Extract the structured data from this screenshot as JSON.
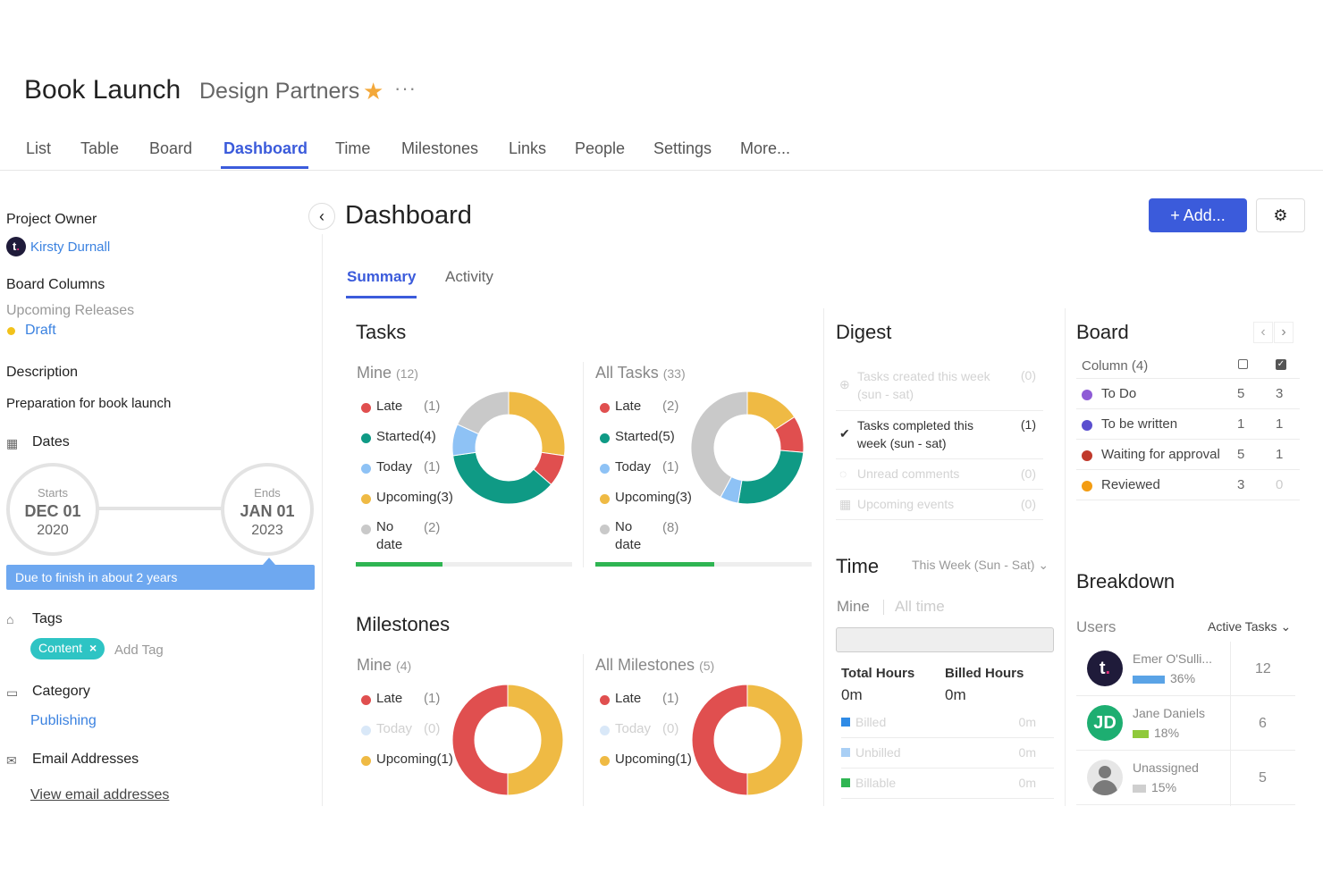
{
  "header": {
    "title": "Book Launch",
    "subtitle": "Design Partners",
    "star_icon": "star-icon",
    "more_icon": "ellipsis-icon"
  },
  "nav": {
    "tabs": [
      "List",
      "Table",
      "Board",
      "Dashboard",
      "Time",
      "Milestones",
      "Links",
      "People",
      "Settings",
      "More..."
    ],
    "active": "Dashboard"
  },
  "sidebar": {
    "project_owner_label": "Project Owner",
    "owner_name": "Kirsty Durnall",
    "board_columns_label": "Board Columns",
    "board_columns_group": "Upcoming Releases",
    "board_column_value": "Draft",
    "board_column_color": "#f2c21b",
    "description_label": "Description",
    "description_value": "Preparation for book launch",
    "dates_label": "Dates",
    "start": {
      "label": "Starts",
      "date": "DEC 01",
      "year": "2020"
    },
    "end": {
      "label": "Ends",
      "date": "JAN 01",
      "year": "2023"
    },
    "due_text": "Due to finish in about 2 years",
    "tags_label": "Tags",
    "tag": "Content",
    "tag_remove": "×",
    "add_tag": "Add Tag",
    "category_label": "Category",
    "category_value": "Publishing",
    "email_label": "Email Addresses",
    "email_link": "View email addresses"
  },
  "main": {
    "title": "Dashboard",
    "add_button": "+ Add...",
    "subtabs": [
      "Summary",
      "Activity"
    ]
  },
  "colors": {
    "late": "#e04f4f",
    "started": "#0f9a85",
    "today": "#8ec2f5",
    "upcoming": "#efba44",
    "nodate": "#c9c9c9",
    "accent": "#3b5bdb"
  },
  "tasks": {
    "title": "Tasks",
    "mine": {
      "label": "Mine",
      "count": "(12)",
      "legend": [
        {
          "label": "Late",
          "count": "(1)"
        },
        {
          "label": "Started(4)",
          "count": ""
        },
        {
          "label": "Today",
          "count": "(1)"
        },
        {
          "label": "Upcoming(3)",
          "count": ""
        },
        {
          "label": "No date",
          "count": "(2)"
        }
      ],
      "slices": [
        {
          "k": "upcoming",
          "v": 3
        },
        {
          "k": "late",
          "v": 1
        },
        {
          "k": "started",
          "v": 4
        },
        {
          "k": "today",
          "v": 1
        },
        {
          "k": "nodate",
          "v": 2
        }
      ],
      "progress": 0.4
    },
    "all": {
      "label": "All Tasks",
      "count": "(33)",
      "legend": [
        {
          "label": "Late",
          "count": "(2)"
        },
        {
          "label": "Started(5)",
          "count": ""
        },
        {
          "label": "Today",
          "count": "(1)"
        },
        {
          "label": "Upcoming(3)",
          "count": ""
        },
        {
          "label": "No date",
          "count": "(8)"
        }
      ],
      "slices": [
        {
          "k": "upcoming",
          "v": 3
        },
        {
          "k": "late",
          "v": 2
        },
        {
          "k": "started",
          "v": 5
        },
        {
          "k": "today",
          "v": 1
        },
        {
          "k": "nodate",
          "v": 8
        }
      ],
      "progress": 0.55
    }
  },
  "milestones": {
    "title": "Milestones",
    "mine": {
      "label": "Mine",
      "count": "(4)",
      "legend": [
        {
          "label": "Late",
          "count": "(1)",
          "faded": false
        },
        {
          "label": "Today",
          "count": "(0)",
          "faded": true
        },
        {
          "label": "Upcoming(1)",
          "count": "",
          "faded": false
        }
      ],
      "slices": [
        {
          "k": "upcoming",
          "v": 1
        },
        {
          "k": "late",
          "v": 1
        }
      ]
    },
    "all": {
      "label": "All Milestones",
      "count": "(5)",
      "legend": [
        {
          "label": "Late",
          "count": "(1)",
          "faded": false
        },
        {
          "label": "Today",
          "count": "(0)",
          "faded": true
        },
        {
          "label": "Upcoming(1)",
          "count": "",
          "faded": false
        }
      ],
      "slices": [
        {
          "k": "upcoming",
          "v": 1
        },
        {
          "k": "late",
          "v": 1
        }
      ]
    }
  },
  "digest": {
    "title": "Digest",
    "rows": [
      {
        "label": "Tasks created this week (sun - sat)",
        "count": "(0)",
        "faded": true
      },
      {
        "label": "Tasks completed this week (sun - sat)",
        "count": "(1)",
        "faded": false
      },
      {
        "label": "Unread comments",
        "count": "(0)",
        "faded": true
      },
      {
        "label": "Upcoming events",
        "count": "(0)",
        "faded": true
      }
    ]
  },
  "time": {
    "title": "Time",
    "range": "This Week (Sun - Sat)",
    "mine_tab": "Mine",
    "alltime_tab": "All time",
    "total_label": "Total Hours",
    "total_value": "0m",
    "billed_label": "Billed Hours",
    "billed_value": "0m",
    "rows": [
      {
        "label": "Billed",
        "value": "0m",
        "color": "#2f8be6"
      },
      {
        "label": "Unbilled",
        "value": "0m",
        "color": "#a9cff5"
      },
      {
        "label": "Billable",
        "value": "0m",
        "color": "#2fb552"
      }
    ]
  },
  "board": {
    "title": "Board",
    "column_header": "Column (4)",
    "rows": [
      {
        "label": "To Do",
        "v1": "5",
        "v2": "3",
        "color": "#8e5bd6"
      },
      {
        "label": "To be written",
        "v1": "1",
        "v2": "1",
        "color": "#5a4fcf"
      },
      {
        "label": "Waiting for approval",
        "v1": "5",
        "v2": "1",
        "color": "#c0392b"
      },
      {
        "label": "Reviewed",
        "v1": "3",
        "v2": "0",
        "color": "#f39c12"
      }
    ]
  },
  "breakdown": {
    "title": "Breakdown",
    "users_label": "Users",
    "metric": "Active Tasks",
    "users": [
      {
        "name": "Emer O'Sulli...",
        "pct": "36%",
        "pct_value": 0.36,
        "count": "12",
        "color": "#5aa3e6",
        "initials": "t."
      },
      {
        "name": "Jane Daniels",
        "pct": "18%",
        "pct_value": 0.18,
        "count": "6",
        "color": "#8fc93a",
        "initials": "JD"
      },
      {
        "name": "Unassigned",
        "pct": "15%",
        "pct_value": 0.15,
        "count": "5",
        "color": "#cfcfcf",
        "initials": ""
      }
    ]
  }
}
